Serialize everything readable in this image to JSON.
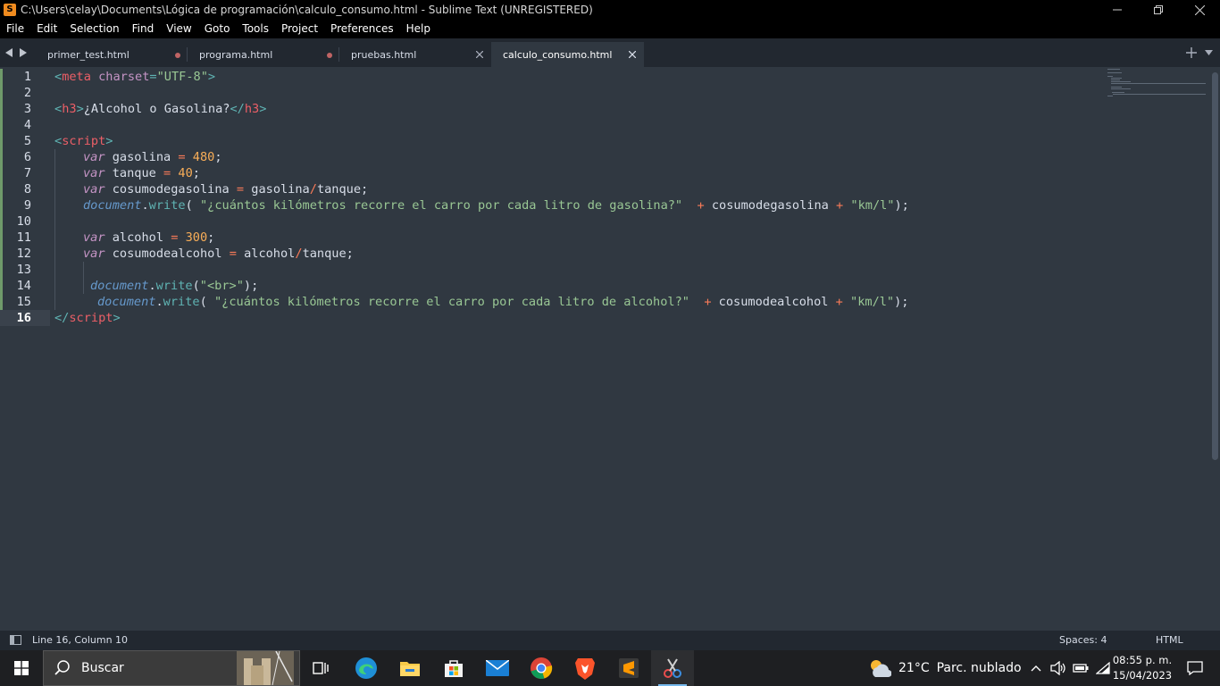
{
  "window": {
    "title": "C:\\Users\\celay\\Documents\\Lógica de programación\\calculo_consumo.html - Sublime Text (UNREGISTERED)"
  },
  "menu": [
    "File",
    "Edit",
    "Selection",
    "Find",
    "View",
    "Goto",
    "Tools",
    "Project",
    "Preferences",
    "Help"
  ],
  "tabs": [
    {
      "label": "primer_test.html",
      "state": "modified"
    },
    {
      "label": "programa.html",
      "state": "modified"
    },
    {
      "label": "pruebas.html",
      "state": "closable"
    },
    {
      "label": "calculo_consumo.html",
      "state": "active"
    }
  ],
  "editor": {
    "current_line": 16,
    "lines": [
      {
        "n": "1"
      },
      {
        "n": "2"
      },
      {
        "n": "3"
      },
      {
        "n": "4"
      },
      {
        "n": "5"
      },
      {
        "n": "6"
      },
      {
        "n": "7"
      },
      {
        "n": "8"
      },
      {
        "n": "9"
      },
      {
        "n": "10"
      },
      {
        "n": "11"
      },
      {
        "n": "12"
      },
      {
        "n": "13"
      },
      {
        "n": "14"
      },
      {
        "n": "15"
      },
      {
        "n": "16"
      }
    ],
    "tokens": {
      "l1": [
        "<",
        "meta",
        " ",
        "charset",
        "=",
        "\"UTF-8\"",
        ">"
      ],
      "l3": [
        "<",
        "h3",
        ">",
        "¿Alcohol o Gasolina?",
        "</",
        "h3",
        ">"
      ],
      "l5": [
        "<",
        "script",
        ">"
      ],
      "l6": [
        "var",
        " gasolina ",
        "=",
        " ",
        "480",
        ";"
      ],
      "l7": [
        "var",
        " tanque ",
        "=",
        " ",
        "40",
        ";"
      ],
      "l8": [
        "var",
        " cosumodegasolina ",
        "=",
        " gasolina",
        "/",
        "tanque;"
      ],
      "l9": [
        "document",
        ".",
        "write",
        "( ",
        "\"¿cuántos kilómetros recorre el carro por cada litro de gasolina?\"",
        "  ",
        "+",
        " cosumodegasolina ",
        "+",
        " ",
        "\"km/l\"",
        ");"
      ],
      "l11": [
        "var",
        " alcohol ",
        "=",
        " ",
        "300",
        ";"
      ],
      "l12": [
        "var",
        " cosumodealcohol ",
        "=",
        " alcohol",
        "/",
        "tanque;"
      ],
      "l14": [
        "document",
        ".",
        "write",
        "(",
        "\"<br>\"",
        ");"
      ],
      "l15": [
        "document",
        ".",
        "write",
        "( ",
        "\"¿cuántos kilómetros recorre el carro por cada litro de alcohol?\"",
        "  ",
        "+",
        " cosumodealcohol ",
        "+",
        " ",
        "\"km/l\"",
        ");"
      ],
      "l16": [
        "</",
        "script",
        ">"
      ]
    }
  },
  "status": {
    "position": "Line 16, Column 10",
    "indent": "Spaces: 4",
    "syntax": "HTML"
  },
  "taskbar": {
    "search_placeholder": "Buscar",
    "weather_temp": "21°C",
    "weather_desc": "Parc. nublado",
    "time": "08:55 p. m.",
    "date": "15/04/2023"
  },
  "colors": {
    "editor_bg": "#303841",
    "tag": "#ec5f67",
    "string": "#99c794",
    "keyword": "#c594c5",
    "number": "#f9ae58",
    "object": "#6699cc"
  }
}
